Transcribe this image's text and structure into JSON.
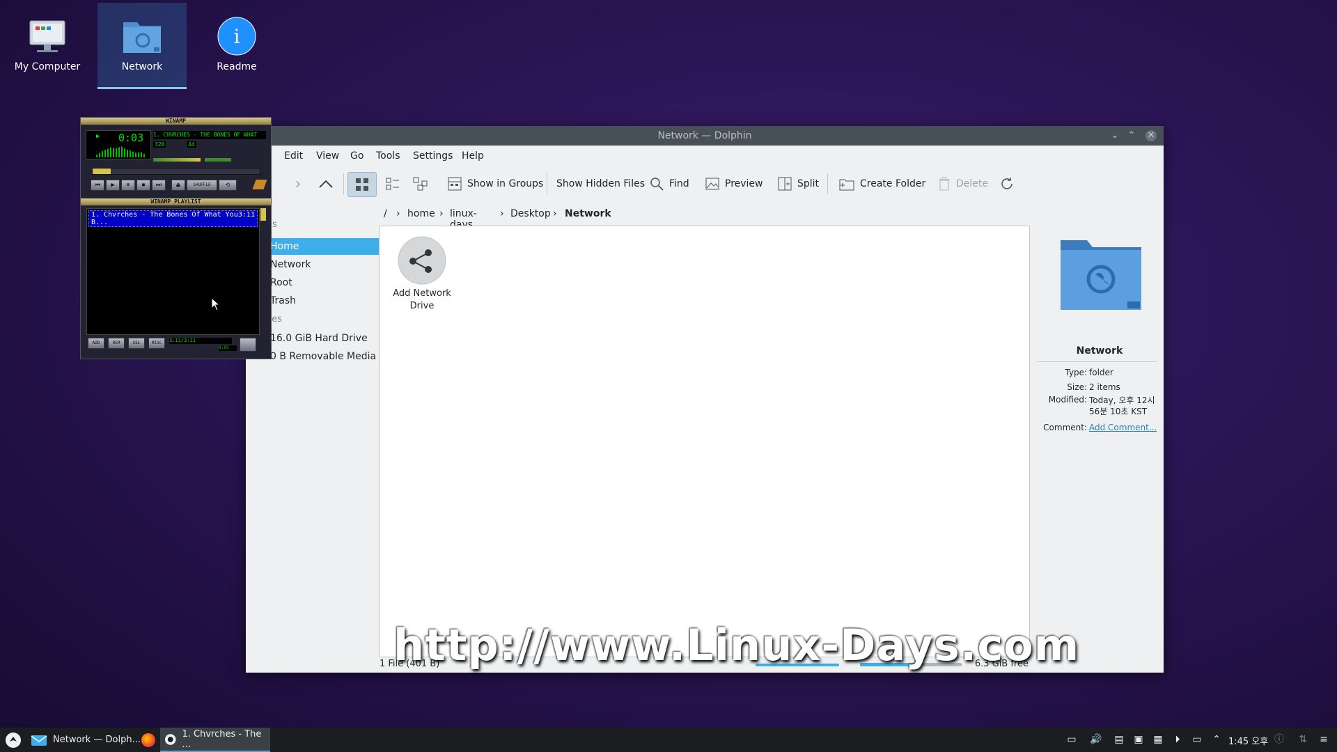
{
  "desktop": {
    "icons": [
      {
        "label": "My Computer",
        "icon": "computer-icon"
      },
      {
        "label": "Network",
        "icon": "network-folder-icon"
      },
      {
        "label": "Readme",
        "icon": "info-icon"
      }
    ]
  },
  "dolphin": {
    "title": "Network — Dolphin",
    "menu": [
      "Edit",
      "View",
      "Go",
      "Tools",
      "Settings",
      "Help"
    ],
    "toolbar": {
      "show_in_groups": "Show in Groups",
      "show_hidden": "Show Hidden Files",
      "find": "Find",
      "preview": "Preview",
      "split": "Split",
      "create_folder": "Create Folder",
      "delete": "Delete"
    },
    "breadcrumb": [
      "/",
      "home",
      "linux-days",
      "Desktop",
      "Network"
    ],
    "places": {
      "header1": "es",
      "items1": [
        "Home",
        "Network",
        "Root",
        "Trash"
      ],
      "header2": "ces",
      "items2": [
        "16.0 GiB Hard Drive",
        "0 B Removable Media"
      ],
      "selected": "Home"
    },
    "files": [
      {
        "name": "Add Network Drive",
        "icon": "network-share-icon"
      }
    ],
    "info": {
      "name": "Network",
      "type_label": "Type:",
      "type": "folder",
      "size_label": "Size:",
      "size": "2 items",
      "modified_label": "Modified:",
      "modified": "Today, 오후 12시 56분 10초 KST",
      "comment_label": "Comment:",
      "comment": "Add Comment..."
    },
    "status": {
      "left": "1 File (401 B)",
      "free": "6.3 GiB free",
      "usage_fraction": 0.6
    }
  },
  "winamp": {
    "title": "WINAMP",
    "time": "0:03",
    "song": "1. CHVRCHES - THE BONES OF WHAT",
    "kbps": "320",
    "khz": "44",
    "playlist_title": "WINAMP PLAYLIST",
    "playlist": [
      {
        "name": "1. Chvrches - The Bones Of What You B...",
        "length": "3:11"
      }
    ],
    "pl_buttons": [
      "ADD",
      "REM",
      "SEL",
      "MISC"
    ],
    "pl_time": "3:11/3:11",
    "pl_elapsed": "0:03"
  },
  "taskbar": {
    "tasks": [
      {
        "label": "Network — Dolph...",
        "icon": "dolphin-icon"
      },
      {
        "label": "1. Chvrches - The ...",
        "icon": "winamp-icon",
        "active": true
      }
    ],
    "clock": "1:45 오후"
  },
  "watermark": "http://www.Linux-Days.com"
}
